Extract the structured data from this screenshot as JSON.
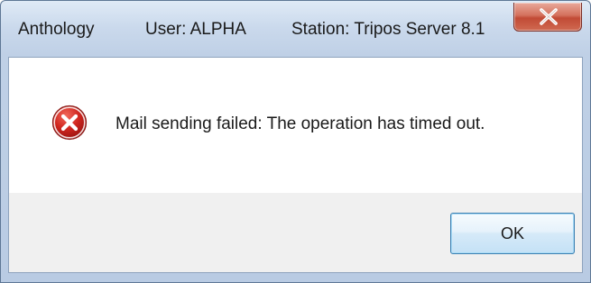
{
  "window": {
    "title": {
      "app": "Anthology",
      "user": "User: ALPHA",
      "station": "Station: Tripos Server 8.1"
    },
    "close_icon": "close-x-icon"
  },
  "dialog": {
    "icon": "error-icon",
    "message": "Mail sending failed: The operation has timed out.",
    "ok_label": "OK"
  },
  "colors": {
    "error_red": "#c8211e",
    "close_button_red": "#c24a35",
    "button_border_blue": "#3c7fb1"
  }
}
